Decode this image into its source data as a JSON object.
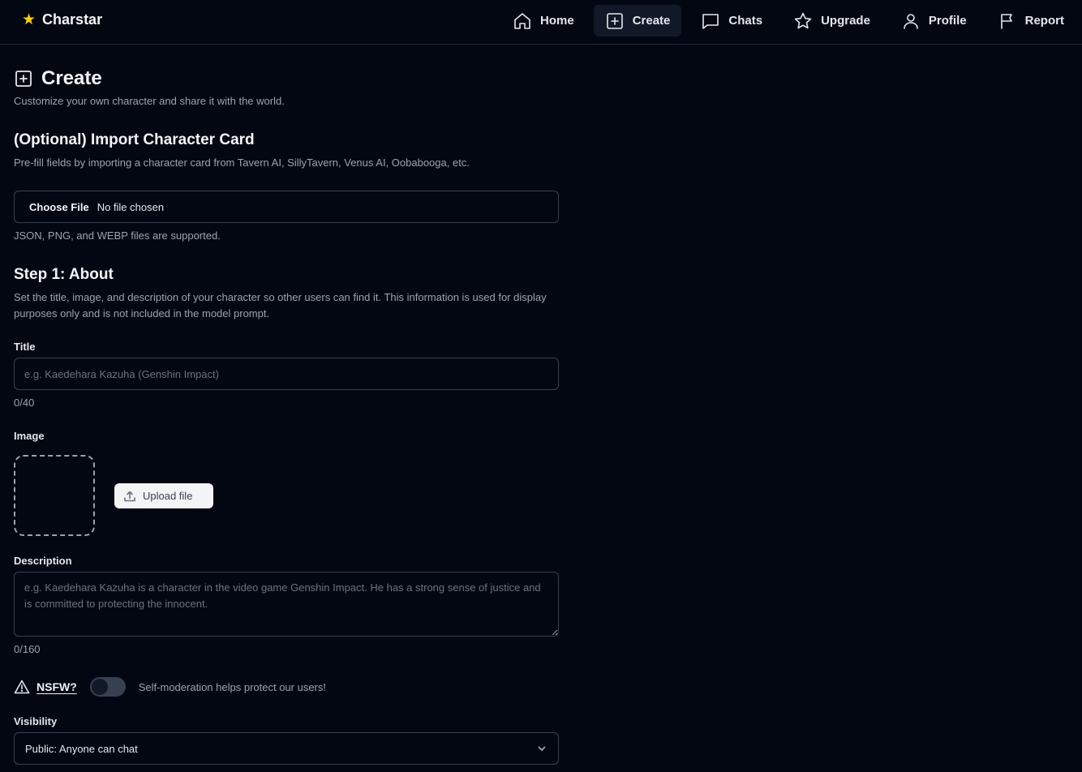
{
  "header": {
    "brand": "Charstar",
    "nav": [
      {
        "label": "Home",
        "icon": "home-icon"
      },
      {
        "label": "Create",
        "icon": "plus-square-icon",
        "active": true
      },
      {
        "label": "Chats",
        "icon": "chat-bubble-icon"
      },
      {
        "label": "Upgrade",
        "icon": "star-icon"
      },
      {
        "label": "Profile",
        "icon": "user-icon"
      },
      {
        "label": "Report",
        "icon": "flag-icon"
      }
    ]
  },
  "page": {
    "title": "Create",
    "subtitle": "Customize your own character and share it with the world."
  },
  "import": {
    "heading": "(Optional) Import Character Card",
    "description": "Pre-fill fields by importing a character card from Tavern AI, SillyTavern, Venus AI, Oobabooga, etc.",
    "button": "Choose File",
    "status": "No file chosen",
    "hint": "JSON, PNG, and WEBP files are supported."
  },
  "step1": {
    "heading": "Step 1: About",
    "description": "Set the title, image, and description of your character so other users can find it. This information is used for display purposes only and is not included in the model prompt.",
    "title_label": "Title",
    "title_placeholder": "e.g. Kaedehara Kazuha (Genshin Impact)",
    "title_count": "0/40",
    "image_label": "Image",
    "upload_label": "Upload file",
    "description_label": "Description",
    "description_placeholder": "e.g. Kaedehara Kazuha is a character in the video game Genshin Impact. He has a strong sense of justice and is committed to protecting the innocent.",
    "description_count": "0/160",
    "nsfw_label": "NSFW?",
    "nsfw_hint": "Self-moderation helps protect our users!",
    "visibility_label": "Visibility",
    "visibility_value": "Public: Anyone can chat"
  },
  "colors": {
    "background": "#030712",
    "border": "#374151",
    "muted_text": "#9ca3af",
    "brand_star": "#facc15"
  }
}
